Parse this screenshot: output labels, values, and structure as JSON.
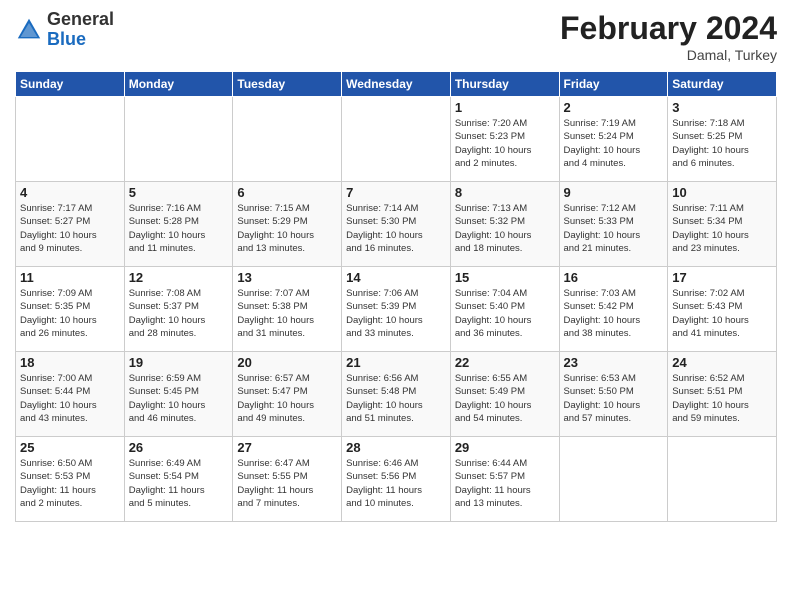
{
  "header": {
    "logo_line1": "General",
    "logo_line2": "Blue",
    "month": "February 2024",
    "location": "Damal, Turkey"
  },
  "days_of_week": [
    "Sunday",
    "Monday",
    "Tuesday",
    "Wednesday",
    "Thursday",
    "Friday",
    "Saturday"
  ],
  "weeks": [
    [
      {
        "num": "",
        "info": ""
      },
      {
        "num": "",
        "info": ""
      },
      {
        "num": "",
        "info": ""
      },
      {
        "num": "",
        "info": ""
      },
      {
        "num": "1",
        "info": "Sunrise: 7:20 AM\nSunset: 5:23 PM\nDaylight: 10 hours\nand 2 minutes."
      },
      {
        "num": "2",
        "info": "Sunrise: 7:19 AM\nSunset: 5:24 PM\nDaylight: 10 hours\nand 4 minutes."
      },
      {
        "num": "3",
        "info": "Sunrise: 7:18 AM\nSunset: 5:25 PM\nDaylight: 10 hours\nand 6 minutes."
      }
    ],
    [
      {
        "num": "4",
        "info": "Sunrise: 7:17 AM\nSunset: 5:27 PM\nDaylight: 10 hours\nand 9 minutes."
      },
      {
        "num": "5",
        "info": "Sunrise: 7:16 AM\nSunset: 5:28 PM\nDaylight: 10 hours\nand 11 minutes."
      },
      {
        "num": "6",
        "info": "Sunrise: 7:15 AM\nSunset: 5:29 PM\nDaylight: 10 hours\nand 13 minutes."
      },
      {
        "num": "7",
        "info": "Sunrise: 7:14 AM\nSunset: 5:30 PM\nDaylight: 10 hours\nand 16 minutes."
      },
      {
        "num": "8",
        "info": "Sunrise: 7:13 AM\nSunset: 5:32 PM\nDaylight: 10 hours\nand 18 minutes."
      },
      {
        "num": "9",
        "info": "Sunrise: 7:12 AM\nSunset: 5:33 PM\nDaylight: 10 hours\nand 21 minutes."
      },
      {
        "num": "10",
        "info": "Sunrise: 7:11 AM\nSunset: 5:34 PM\nDaylight: 10 hours\nand 23 minutes."
      }
    ],
    [
      {
        "num": "11",
        "info": "Sunrise: 7:09 AM\nSunset: 5:35 PM\nDaylight: 10 hours\nand 26 minutes."
      },
      {
        "num": "12",
        "info": "Sunrise: 7:08 AM\nSunset: 5:37 PM\nDaylight: 10 hours\nand 28 minutes."
      },
      {
        "num": "13",
        "info": "Sunrise: 7:07 AM\nSunset: 5:38 PM\nDaylight: 10 hours\nand 31 minutes."
      },
      {
        "num": "14",
        "info": "Sunrise: 7:06 AM\nSunset: 5:39 PM\nDaylight: 10 hours\nand 33 minutes."
      },
      {
        "num": "15",
        "info": "Sunrise: 7:04 AM\nSunset: 5:40 PM\nDaylight: 10 hours\nand 36 minutes."
      },
      {
        "num": "16",
        "info": "Sunrise: 7:03 AM\nSunset: 5:42 PM\nDaylight: 10 hours\nand 38 minutes."
      },
      {
        "num": "17",
        "info": "Sunrise: 7:02 AM\nSunset: 5:43 PM\nDaylight: 10 hours\nand 41 minutes."
      }
    ],
    [
      {
        "num": "18",
        "info": "Sunrise: 7:00 AM\nSunset: 5:44 PM\nDaylight: 10 hours\nand 43 minutes."
      },
      {
        "num": "19",
        "info": "Sunrise: 6:59 AM\nSunset: 5:45 PM\nDaylight: 10 hours\nand 46 minutes."
      },
      {
        "num": "20",
        "info": "Sunrise: 6:57 AM\nSunset: 5:47 PM\nDaylight: 10 hours\nand 49 minutes."
      },
      {
        "num": "21",
        "info": "Sunrise: 6:56 AM\nSunset: 5:48 PM\nDaylight: 10 hours\nand 51 minutes."
      },
      {
        "num": "22",
        "info": "Sunrise: 6:55 AM\nSunset: 5:49 PM\nDaylight: 10 hours\nand 54 minutes."
      },
      {
        "num": "23",
        "info": "Sunrise: 6:53 AM\nSunset: 5:50 PM\nDaylight: 10 hours\nand 57 minutes."
      },
      {
        "num": "24",
        "info": "Sunrise: 6:52 AM\nSunset: 5:51 PM\nDaylight: 10 hours\nand 59 minutes."
      }
    ],
    [
      {
        "num": "25",
        "info": "Sunrise: 6:50 AM\nSunset: 5:53 PM\nDaylight: 11 hours\nand 2 minutes."
      },
      {
        "num": "26",
        "info": "Sunrise: 6:49 AM\nSunset: 5:54 PM\nDaylight: 11 hours\nand 5 minutes."
      },
      {
        "num": "27",
        "info": "Sunrise: 6:47 AM\nSunset: 5:55 PM\nDaylight: 11 hours\nand 7 minutes."
      },
      {
        "num": "28",
        "info": "Sunrise: 6:46 AM\nSunset: 5:56 PM\nDaylight: 11 hours\nand 10 minutes."
      },
      {
        "num": "29",
        "info": "Sunrise: 6:44 AM\nSunset: 5:57 PM\nDaylight: 11 hours\nand 13 minutes."
      },
      {
        "num": "",
        "info": ""
      },
      {
        "num": "",
        "info": ""
      }
    ]
  ]
}
